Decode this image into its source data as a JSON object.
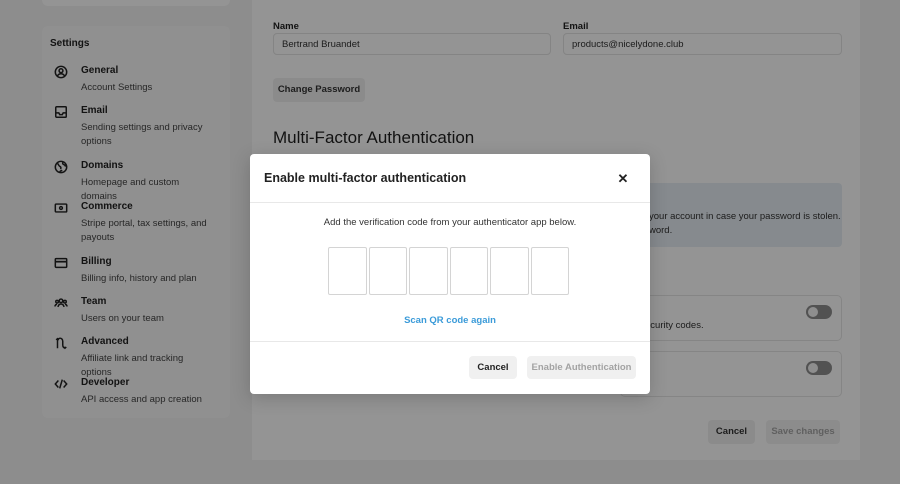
{
  "sidebar": {
    "title": "Settings",
    "items": [
      {
        "title": "General",
        "desc": "Account Settings",
        "icon": "user-circle-icon"
      },
      {
        "title": "Email",
        "desc": "Sending settings and privacy options",
        "icon": "inbox-icon"
      },
      {
        "title": "Domains",
        "desc": "Homepage and custom domains",
        "icon": "globe-icon"
      },
      {
        "title": "Commerce",
        "desc": "Stripe portal, tax settings, and payouts",
        "icon": "wallet-icon"
      },
      {
        "title": "Billing",
        "desc": "Billing info, history and plan",
        "icon": "credit-card-icon"
      },
      {
        "title": "Team",
        "desc": "Users on your team",
        "icon": "team-icon"
      },
      {
        "title": "Advanced",
        "desc": "Affiliate link and tracking options",
        "icon": "affiliate-icon"
      },
      {
        "title": "Developer",
        "desc": "API access and app creation",
        "icon": "code-icon"
      }
    ]
  },
  "profile": {
    "name_label": "Name",
    "name_value": "Bertrand Bruandet",
    "email_label": "Email",
    "email_value": "products@nicelydone.club",
    "change_password": "Change Password"
  },
  "mfa": {
    "title": "Multi-Factor Authentication",
    "info_line1": "your account in case your password is stolen.",
    "info_line2": "word.",
    "card1_text": "ecurity codes."
  },
  "footer": {
    "cancel": "Cancel",
    "save": "Save changes"
  },
  "modal": {
    "title": "Enable multi-factor authentication",
    "close_icon": "close-icon",
    "instruction": "Add the verification code from your authenticator app below.",
    "code_boxes": 6,
    "scan_link": "Scan QR code again",
    "cancel": "Cancel",
    "enable": "Enable Authentication"
  },
  "colors": {
    "link": "#3b9bd9",
    "overlay": "rgba(0,0,0,0.42)",
    "info_bg": "#e7eef4"
  }
}
